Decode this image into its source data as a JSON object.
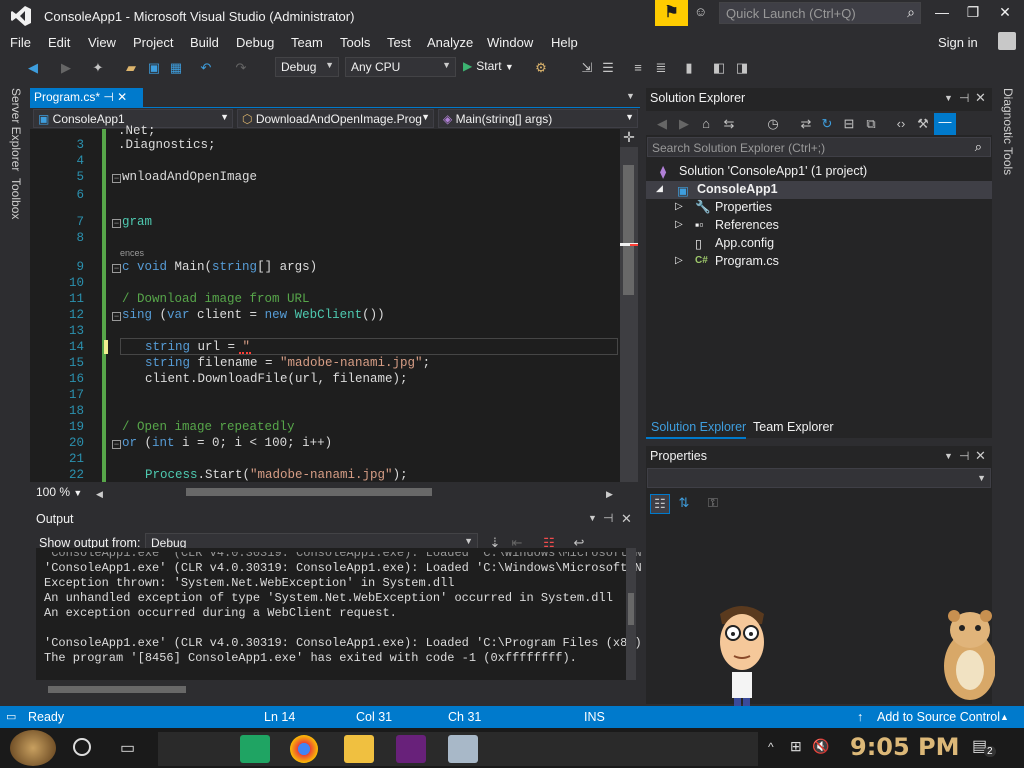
{
  "window": {
    "title": "ConsoleApp1 - Microsoft Visual Studio  (Administrator)"
  },
  "quick_launch": {
    "placeholder": "Quick Launch (Ctrl+Q)"
  },
  "menu": [
    "File",
    "Edit",
    "View",
    "Project",
    "Build",
    "Debug",
    "Team",
    "Tools",
    "Test",
    "Analyze",
    "Window",
    "Help"
  ],
  "signin": "Sign in",
  "toolbar": {
    "config": "Debug",
    "platform": "Any CPU",
    "start": "Start"
  },
  "left_tabs": [
    "Server Explorer",
    "Toolbox"
  ],
  "right_tabs": [
    "Diagnostic Tools"
  ],
  "editor": {
    "tab": "Program.cs*",
    "nav_project": "ConsoleApp1",
    "nav_class": "DownloadAndOpenImage.Prog",
    "nav_member": "Main(string[] args)",
    "zoom": "100 %",
    "line_numbers": [
      "3",
      "4",
      "5",
      "6",
      "7",
      "8",
      "9",
      "10",
      "11",
      "12",
      "13",
      "14",
      "15",
      "16",
      "17",
      "18",
      "19",
      "20",
      "21",
      "22"
    ],
    "codelens": "ences",
    "lines": {
      "l2": ".Net;",
      "l3": ".Diagnostics;",
      "l5": "wnloadAndOpenImage",
      "l7": "gram",
      "l9a": "c ",
      "l9b": "void",
      "l9c": " Main(",
      "l9d": "string",
      "l9e": "[] args)",
      "l11": "/ Download image from URL",
      "l12a": "sing",
      "l12b": " (",
      "l12c": "var",
      "l12d": " client = ",
      "l12e": "new",
      "l12f": " ",
      "l12g": "WebClient",
      "l12h": "())",
      "l14a": "string",
      "l14b": " url = ",
      "l14c": "\"",
      "l15a": "string",
      "l15b": " filename = ",
      "l15c": "\"madobe-nanami.jpg\"",
      "l15d": ";",
      "l16": "client.DownloadFile(url, filename);",
      "l19": "/ Open image repeatedly",
      "l20a": "or",
      "l20b": " (",
      "l20c": "int",
      "l20d": " i = 0; i < 100; i++)",
      "l22a": "Process",
      "l22b": ".Start(",
      "l22c": "\"madobe-nanami.jpg\"",
      "l22d": ");"
    }
  },
  "output": {
    "title": "Output",
    "show_from_label": "Show output from:",
    "source": "Debug",
    "lines": [
      "'ConsoleApp1.exe' (CLR v4.0.30319: ConsoleApp1.exe): Loaded 'C:\\Windows\\Microsoft.N",
      "'ConsoleApp1.exe' (CLR v4.0.30319: ConsoleApp1.exe): Loaded 'C:\\Windows\\Microsoft.N",
      "Exception thrown: 'System.Net.WebException' in System.dll",
      "An unhandled exception of type 'System.Net.WebException' occurred in System.dll",
      "An exception occurred during a WebClient request.",
      "",
      "'ConsoleApp1.exe' (CLR v4.0.30319: ConsoleApp1.exe): Loaded 'C:\\Program Files (x86)",
      "The program '[8456] ConsoleApp1.exe' has exited with code -1 (0xffffffff)."
    ]
  },
  "solution_explorer": {
    "title": "Solution Explorer",
    "search_placeholder": "Search Solution Explorer (Ctrl+;)",
    "solution": "Solution 'ConsoleApp1' (1 project)",
    "project": "ConsoleApp1",
    "items": [
      "Properties",
      "References",
      "App.config",
      "Program.cs"
    ],
    "tabs": [
      "Solution Explorer",
      "Team Explorer"
    ]
  },
  "properties": {
    "title": "Properties"
  },
  "status": {
    "ready": "Ready",
    "ln": "Ln 14",
    "col": "Col 31",
    "ch": "Ch 31",
    "ins": "INS",
    "source_control": "Add to Source Control"
  },
  "taskbar": {
    "time": "9:05 PM",
    "notif_count": "2"
  },
  "colors": {
    "accent": "#007acc",
    "bg": "#2d2d30",
    "editor": "#1e1e1e",
    "flag": "#ffcc00"
  }
}
